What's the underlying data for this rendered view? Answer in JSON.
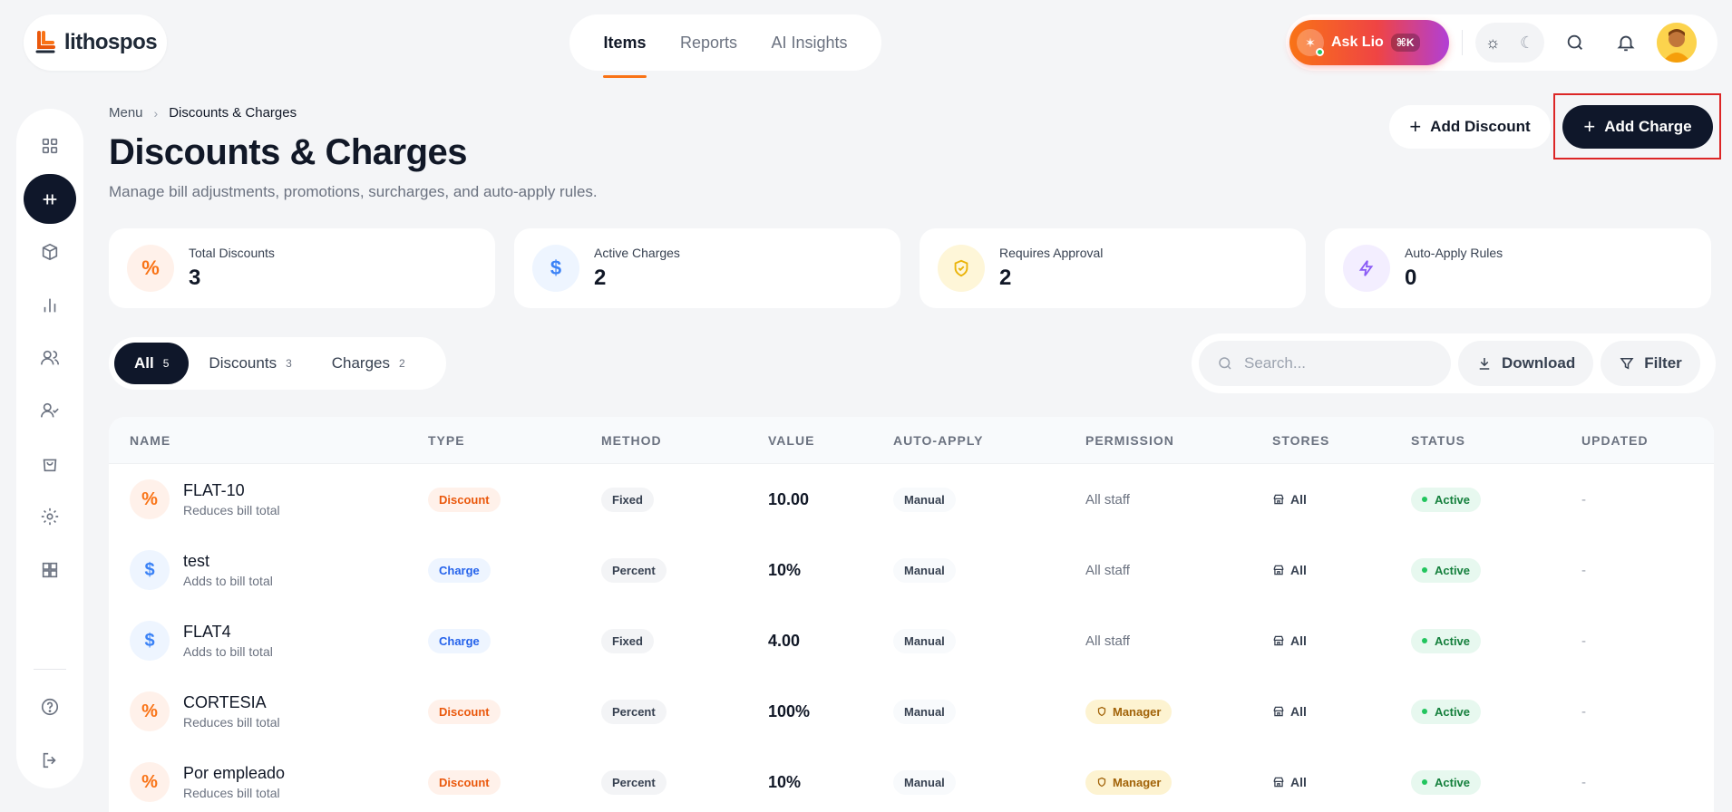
{
  "brand": {
    "name": "lithospos"
  },
  "topnav": {
    "tabs": [
      {
        "label": "Items",
        "active": true
      },
      {
        "label": "Reports",
        "active": false
      },
      {
        "label": "AI Insights",
        "active": false
      }
    ]
  },
  "assistant": {
    "label": "Ask Lio",
    "shortcut": "⌘K"
  },
  "breadcrumb": {
    "parent": "Menu",
    "current": "Discounts & Charges"
  },
  "page": {
    "title": "Discounts & Charges",
    "subtitle": "Manage bill adjustments, promotions, surcharges, and auto-apply rules."
  },
  "actions": {
    "add_discount": "Add Discount",
    "add_charge": "Add Charge"
  },
  "stats": [
    {
      "label": "Total Discounts",
      "value": "3",
      "icon": "percent-icon",
      "color": "#f97316"
    },
    {
      "label": "Active Charges",
      "value": "2",
      "icon": "dollar-icon",
      "color": "#3b82f6"
    },
    {
      "label": "Requires Approval",
      "value": "2",
      "icon": "shield-icon",
      "color": "#eab308"
    },
    {
      "label": "Auto-Apply Rules",
      "value": "0",
      "icon": "bolt-icon",
      "color": "#8b5cf6"
    }
  ],
  "filters": [
    {
      "label": "All",
      "count": "5",
      "active": true
    },
    {
      "label": "Discounts",
      "count": "3",
      "active": false
    },
    {
      "label": "Charges",
      "count": "2",
      "active": false
    }
  ],
  "toolbar": {
    "search_placeholder": "Search...",
    "download": "Download",
    "filter": "Filter"
  },
  "table": {
    "headers": [
      "NAME",
      "TYPE",
      "METHOD",
      "VALUE",
      "AUTO-APPLY",
      "PERMISSION",
      "STORES",
      "STATUS",
      "UPDATED"
    ],
    "rows": [
      {
        "kind": "disc",
        "name": "FLAT-10",
        "desc": "Reduces bill total",
        "type": "Discount",
        "method": "Fixed",
        "value": "10.00",
        "auto": "Manual",
        "perm": "All staff",
        "perm_kind": "text",
        "stores": "All",
        "status": "Active",
        "updated": "-"
      },
      {
        "kind": "chg",
        "name": "test",
        "desc": "Adds to bill total",
        "type": "Charge",
        "method": "Percent",
        "value": "10%",
        "auto": "Manual",
        "perm": "All staff",
        "perm_kind": "text",
        "stores": "All",
        "status": "Active",
        "updated": "-"
      },
      {
        "kind": "chg",
        "name": "FLAT4",
        "desc": "Adds to bill total",
        "type": "Charge",
        "method": "Fixed",
        "value": "4.00",
        "auto": "Manual",
        "perm": "All staff",
        "perm_kind": "text",
        "stores": "All",
        "status": "Active",
        "updated": "-"
      },
      {
        "kind": "disc",
        "name": "CORTESIA",
        "desc": "Reduces bill total",
        "type": "Discount",
        "method": "Percent",
        "value": "100%",
        "auto": "Manual",
        "perm": "Manager",
        "perm_kind": "badge",
        "stores": "All",
        "status": "Active",
        "updated": "-"
      },
      {
        "kind": "disc",
        "name": "Por empleado",
        "desc": "Reduces bill total",
        "type": "Discount",
        "method": "Percent",
        "value": "10%",
        "auto": "Manual",
        "perm": "Manager",
        "perm_kind": "badge",
        "stores": "All",
        "status": "Active",
        "updated": "-"
      }
    ]
  }
}
